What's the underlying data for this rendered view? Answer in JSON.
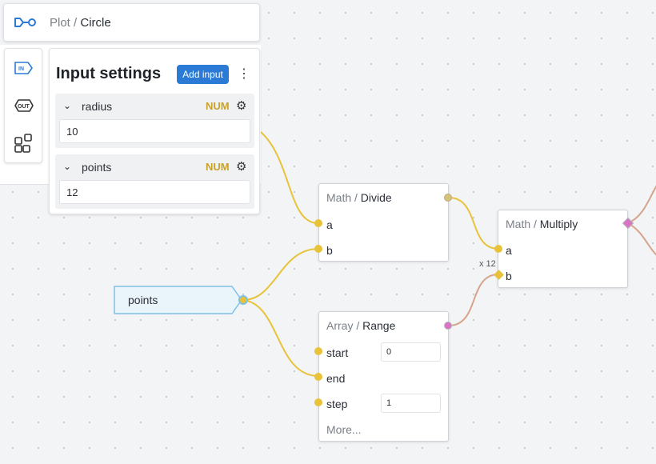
{
  "titlebar": {
    "breadcrumb_parent": "Plot",
    "separator": " / ",
    "breadcrumb_current": "Circle",
    "logo_icon": "graph-logo-icon"
  },
  "toolbar": {
    "tools": [
      {
        "name": "input-node-icon",
        "label": "IN"
      },
      {
        "name": "output-node-icon",
        "label": "OUT"
      },
      {
        "name": "components-icon",
        "label": ""
      }
    ]
  },
  "settings": {
    "title": "Input settings",
    "add_button": "Add input",
    "menu_icon": "⋮",
    "inputs": [
      {
        "name": "radius",
        "type": "NUM",
        "value": "10"
      },
      {
        "name": "points",
        "type": "NUM",
        "value": "12"
      }
    ]
  },
  "nodes": {
    "divide": {
      "category": "Math",
      "sep": " / ",
      "title": "Divide",
      "ports": [
        "a",
        "b"
      ]
    },
    "multiply": {
      "category": "Math",
      "sep": " / ",
      "title": "Multiply",
      "ports": [
        "a",
        "b"
      ],
      "multiplier": "x 12"
    },
    "range": {
      "category": "Array",
      "sep": " / ",
      "title": "Range",
      "ports": [
        "start",
        "end",
        "step"
      ],
      "start_value": "0",
      "step_value": "1",
      "more": "More..."
    },
    "points_param": {
      "label": "points"
    }
  },
  "colors": {
    "accent": "#2b7bd6",
    "num_type": "#c9a227",
    "wire_yellow": "#e8c33a",
    "wire_pink": "#d58aa0",
    "port_pink": "#d873c6",
    "param_bg": "#eaf4fb",
    "param_border": "#7ec0e6"
  }
}
